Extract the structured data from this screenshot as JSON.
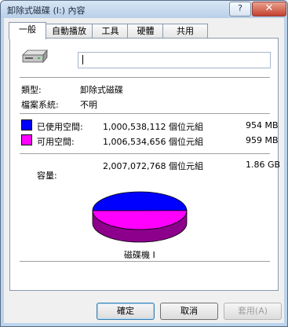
{
  "window": {
    "title": "卸除式磁碟 (I:) 內容",
    "help_label": "?",
    "close_label": "✕"
  },
  "tabs": [
    {
      "label": "一般",
      "active": true
    },
    {
      "label": "自動播放",
      "active": false
    },
    {
      "label": "工具",
      "active": false
    },
    {
      "label": "硬體",
      "active": false
    },
    {
      "label": "共用",
      "active": false
    }
  ],
  "general": {
    "icon": "removable-drive-icon",
    "volume_name_value": "",
    "type_label": "類型:",
    "type_value": "卸除式磁碟",
    "filesystem_label": "檔案系統:",
    "filesystem_value": "不明",
    "used": {
      "label": "已使用空間:",
      "bytes": "1,000,538,112 個位元組",
      "size": "954 MB",
      "color": "#0000ff"
    },
    "free": {
      "label": "可用空間:",
      "bytes": "1,006,534,656 個位元組",
      "size": "959 MB",
      "color": "#ff00ff"
    },
    "capacity": {
      "label": "容量:",
      "bytes": "2,007,072,768 個位元組",
      "size": "1.86 GB"
    },
    "drive_caption": "磁碟機 I"
  },
  "chart_data": {
    "type": "pie",
    "categories": [
      "已使用空間",
      "可用空間"
    ],
    "values": [
      1000538112,
      1006534656
    ],
    "colors": [
      "#0000ff",
      "#ff00ff"
    ],
    "title": "磁碟機 I"
  },
  "buttons": {
    "ok": "確定",
    "cancel": "取消",
    "apply": "套用(A)",
    "apply_enabled": false
  }
}
